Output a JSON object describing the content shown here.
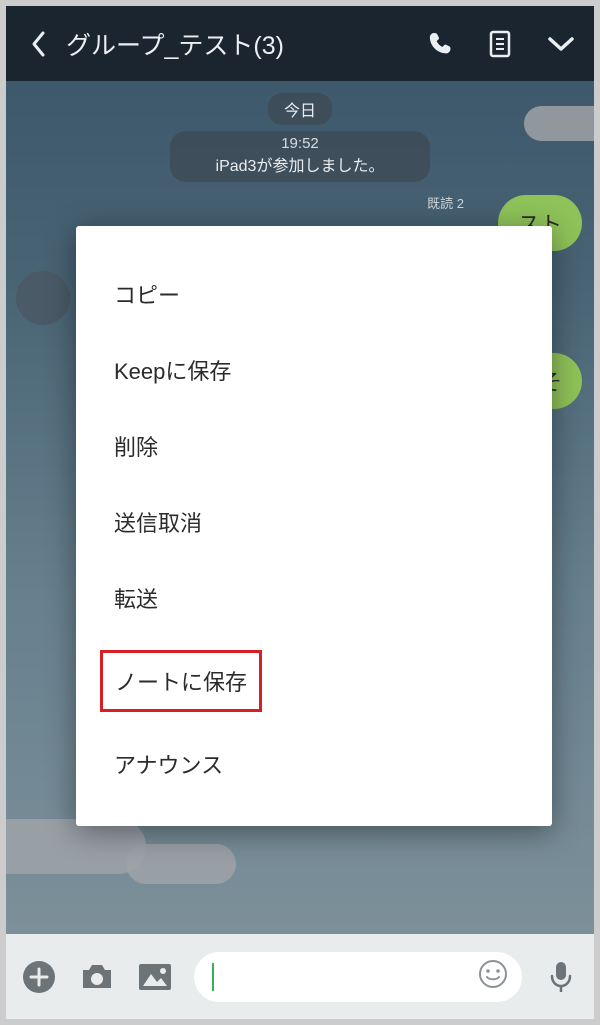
{
  "header": {
    "title": "グループ_テスト(3)"
  },
  "chat": {
    "date_label": "今日",
    "system_time": "19:52",
    "system_message": "iPad3が参加しました。",
    "read_label": "既読 2",
    "bubble1_fragment": "スト",
    "bubble2_fragment": "こそ"
  },
  "context_menu": {
    "items": [
      {
        "label": "コピー",
        "highlighted": false
      },
      {
        "label": "Keepに保存",
        "highlighted": false
      },
      {
        "label": "削除",
        "highlighted": false
      },
      {
        "label": "送信取消",
        "highlighted": false
      },
      {
        "label": "転送",
        "highlighted": false
      },
      {
        "label": "ノートに保存",
        "highlighted": true
      },
      {
        "label": "アナウンス",
        "highlighted": false
      }
    ]
  }
}
